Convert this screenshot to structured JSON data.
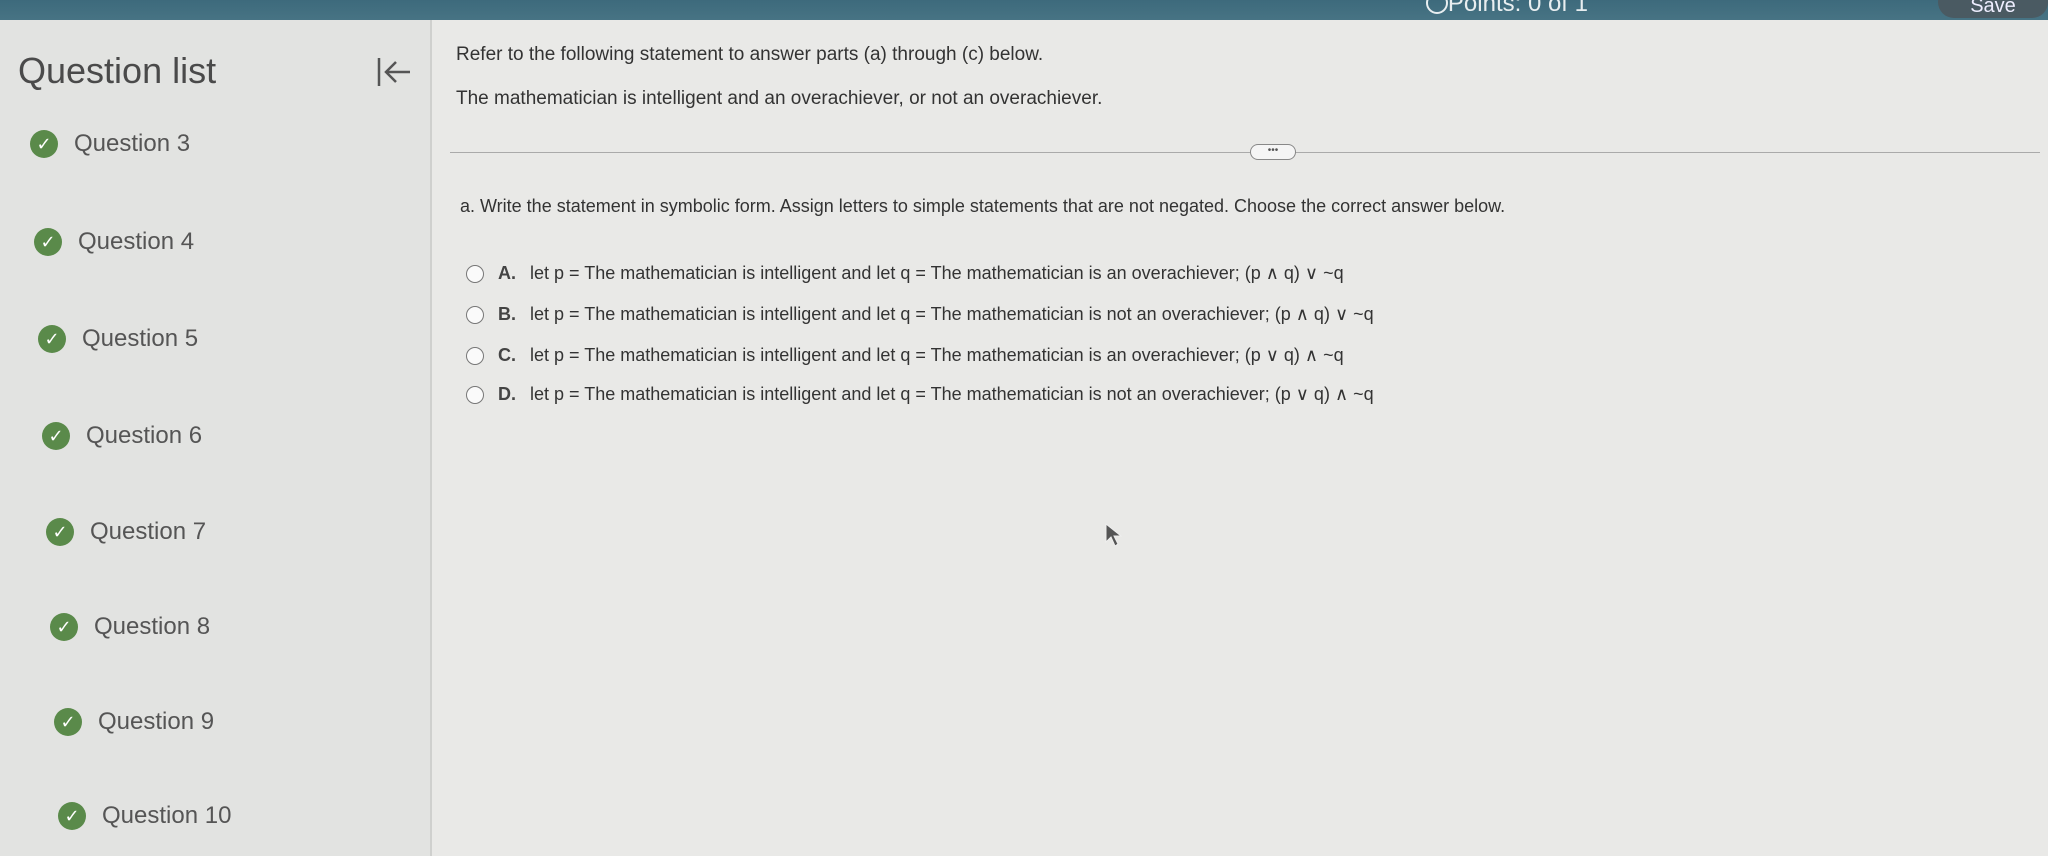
{
  "topbar": {
    "points_label": "Points: 0 of 1",
    "save_label": "Save"
  },
  "sidebar": {
    "title": "Question list",
    "collapse_icon": "collapse-left-icon",
    "items": [
      {
        "label": "Question 3",
        "status": "complete"
      },
      {
        "label": "Question 4",
        "status": "complete"
      },
      {
        "label": "Question 5",
        "status": "complete"
      },
      {
        "label": "Question 6",
        "status": "complete"
      },
      {
        "label": "Question 7",
        "status": "complete"
      },
      {
        "label": "Question 8",
        "status": "complete"
      },
      {
        "label": "Question 9",
        "status": "complete"
      },
      {
        "label": "Question 10",
        "status": "complete"
      }
    ]
  },
  "main": {
    "intro": "Refer to the following statement to answer parts (a) through (c) below.",
    "statement": "The mathematician is intelligent and an overachiever, or not an overachiever.",
    "more_label": "•••",
    "question": "a. Write the statement in symbolic form. Assign letters to simple statements that are not negated. Choose the correct answer below.",
    "options": [
      {
        "letter": "A.",
        "text": "let p = The mathematician is intelligent and let q = The mathematician is an overachiever; (p ∧ q) ∨ ~q"
      },
      {
        "letter": "B.",
        "text": "let p = The mathematician is intelligent and let q = The mathematician is not an overachiever; (p ∧ q) ∨ ~q"
      },
      {
        "letter": "C.",
        "text": "let p = The mathematician is intelligent and let q = The mathematician is an overachiever; (p ∨ q) ∧ ~q"
      },
      {
        "letter": "D.",
        "text": "let p = The mathematician is intelligent and let q = The mathematician is not an overachiever; (p ∨ q) ∧ ~q"
      }
    ]
  },
  "colors": {
    "check": "#5a8a4a",
    "topbar": "#4f7b8a"
  }
}
